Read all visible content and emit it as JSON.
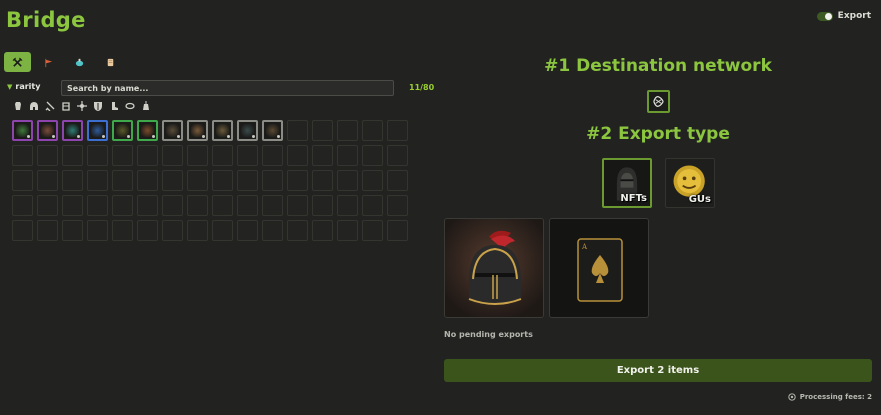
{
  "header": {
    "title": "Bridge",
    "export_toggle_label": "Export",
    "export_toggle_on": true
  },
  "tabs": [
    {
      "icon": "crossed-swords-icon",
      "active": true
    },
    {
      "icon": "flag-icon",
      "active": false
    },
    {
      "icon": "potion-icon",
      "active": false
    },
    {
      "icon": "scroll-icon",
      "active": false
    }
  ],
  "filters": {
    "rarity_label": "rarity",
    "search_placeholder": "Search by name...",
    "count": "11/80",
    "slot_icons": [
      "armor-icon",
      "helmet-icon",
      "sword-icon",
      "gauntlet-icon",
      "crosshair-icon",
      "shield-icon",
      "boots-icon",
      "ring-icon",
      "amulet-icon"
    ]
  },
  "inventory": {
    "columns": 16,
    "rows": 5,
    "items": [
      {
        "name": "shield",
        "rarity_color": "#8e44ad",
        "tint": "#3f7a3a"
      },
      {
        "name": "armor",
        "rarity_color": "#8e44ad",
        "tint": "#7b4b3a"
      },
      {
        "name": "blade",
        "rarity_color": "#8e44ad",
        "tint": "#2f7d74"
      },
      {
        "name": "orb",
        "rarity_color": "#3d6fd1",
        "tint": "#2e5a9a"
      },
      {
        "name": "tome",
        "rarity_color": "#3fa84a",
        "tint": "#5a5a2a"
      },
      {
        "name": "cuirass",
        "rarity_color": "#3fa84a",
        "tint": "#7a4a2a"
      },
      {
        "name": "bow",
        "rarity_color": "#8c8c86",
        "tint": "#5a4c3a"
      },
      {
        "name": "gloves",
        "rarity_color": "#8c8c86",
        "tint": "#7a5a3a"
      },
      {
        "name": "plate",
        "rarity_color": "#8c8c86",
        "tint": "#6a5a3a"
      },
      {
        "name": "wand",
        "rarity_color": "#8c8c86",
        "tint": "#3a4a4a"
      },
      {
        "name": "staff",
        "rarity_color": "#8c8c86",
        "tint": "#5a4a32"
      }
    ]
  },
  "destination": {
    "heading": "#1 Destination network"
  },
  "export_type": {
    "heading": "#2 Export type",
    "options": [
      {
        "label": "NFTs",
        "selected": true
      },
      {
        "label": "GUs",
        "selected": false
      }
    ]
  },
  "selected_items": [
    {
      "name": "helmet"
    },
    {
      "name": "ace-card"
    }
  ],
  "status": {
    "pending_text": "No pending exports",
    "export_button": "Export 2 items",
    "fees_text": "Processing fees: 2"
  },
  "colors": {
    "accent": "#8cc63f",
    "export_button_bg": "#3b541c",
    "background": "#222321"
  }
}
